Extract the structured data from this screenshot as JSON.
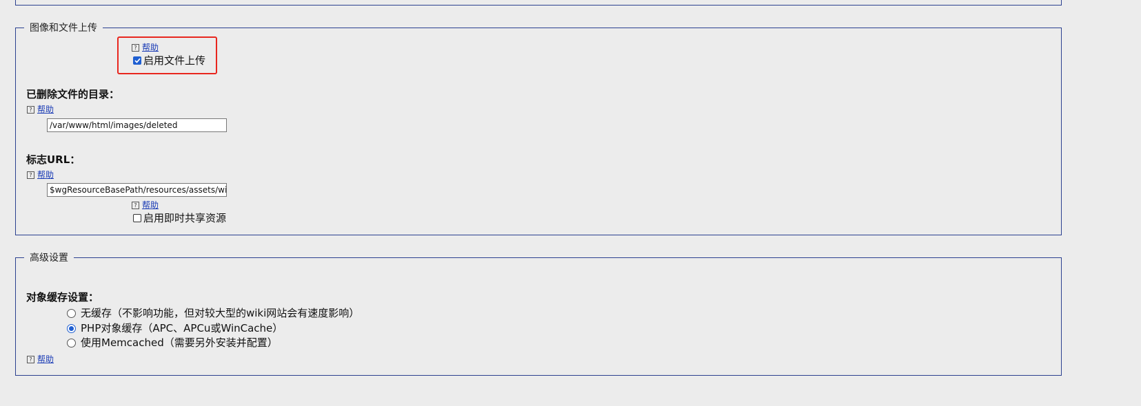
{
  "top_fieldset": {},
  "upload_section": {
    "legend": "图像和文件上传",
    "enable_upload": {
      "help": "帮助",
      "label": "启用文件上传",
      "checked": true
    },
    "deleted_dir": {
      "label": "已删除文件的目录：",
      "help": "帮助",
      "value": "/var/www/html/images/deleted"
    },
    "logo_url": {
      "label": "标志URL：",
      "help": "帮助",
      "value": "$wgResourceBasePath/resources/assets/wik"
    },
    "instant_commons": {
      "help": "帮助",
      "label": "启用即时共享资源",
      "checked": false
    }
  },
  "advanced_section": {
    "legend": "高级设置",
    "cache_label": "对象缓存设置：",
    "options": [
      {
        "label": "无缓存（不影响功能，但对较大型的wiki网站会有速度影响）",
        "checked": false
      },
      {
        "label": "PHP对象缓存（APC、APCu或WinCache）",
        "checked": true
      },
      {
        "label": "使用Memcached（需要另外安装并配置）",
        "checked": false
      }
    ],
    "help": "帮助"
  },
  "colors": {
    "border": "#2a3f8f",
    "link": "#1a3bb5",
    "accent": "#1f5fd1",
    "highlight": "#e8261e"
  }
}
